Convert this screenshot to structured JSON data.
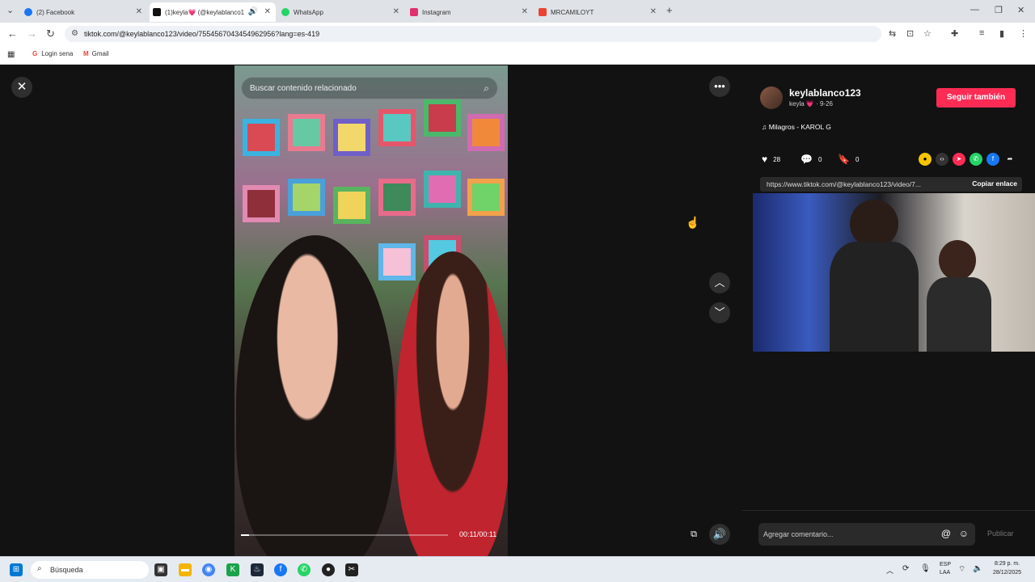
{
  "browser": {
    "tabs": [
      {
        "label": "(2) Facebook",
        "color": "#1877f2"
      },
      {
        "label": "(1)keyla💗 (@keylablanco1",
        "color": "#111111",
        "active": true
      },
      {
        "label": "WhatsApp",
        "color": "#25d366"
      },
      {
        "label": "Instagram",
        "color": "#e1306c"
      },
      {
        "label": "MRCAMILOYT",
        "color": "#ea4335"
      }
    ],
    "url": "tiktok.com/@keylablanco123/video/7554567043454962956?lang=es-419",
    "bookmarks": [
      {
        "label": "Login sena",
        "icon": "google-g-icon"
      },
      {
        "label": "Gmail",
        "icon": "gmail-icon"
      }
    ]
  },
  "video": {
    "search_placeholder": "Buscar contenido relacionado",
    "timer": "00:11/00:11",
    "progress": 0.04
  },
  "author": {
    "username": "keylablanco123",
    "nickname": "keyla 💗",
    "date": "9-26",
    "follow_label": "Seguir también",
    "music": "Milagros - KAROL G"
  },
  "stats": {
    "likes": "28",
    "comments": "0",
    "saves": "0"
  },
  "share": {
    "link": "https://www.tiktok.com/@keylablanco123/video/7...",
    "copy_label": "Copiar enlace"
  },
  "comment": {
    "placeholder": "Agregar comentario...",
    "publish_label": "Publicar"
  },
  "taskbar": {
    "search_label": "Búsqueda",
    "lang_top": "ESP",
    "lang_bottom": "LAA",
    "time": "8:29 p. m.",
    "date": "28/12/2025"
  },
  "colors": {
    "accent": "#fe2c55",
    "background": "#121212"
  }
}
